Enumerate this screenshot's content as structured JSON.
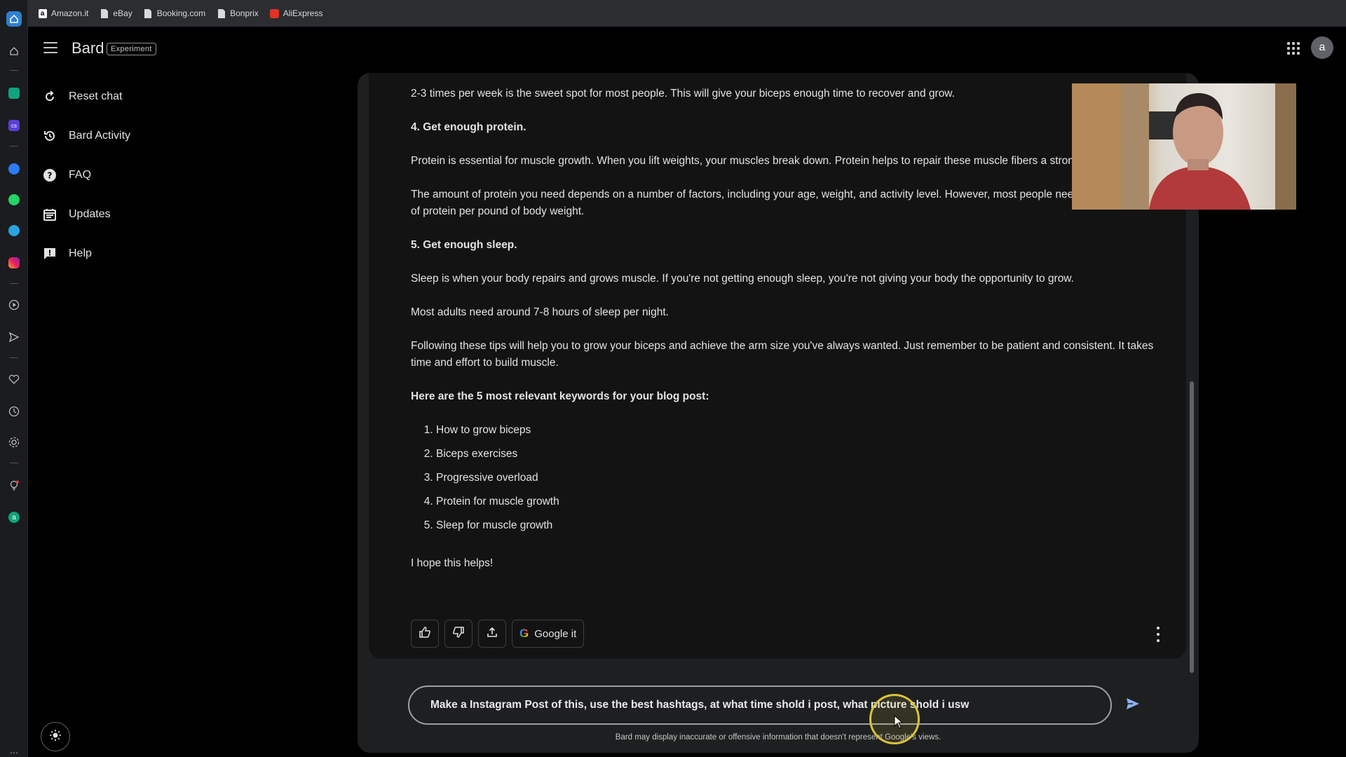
{
  "bookmarks": [
    {
      "label": "Amazon.it",
      "icon": "amazon-icon"
    },
    {
      "label": "eBay",
      "icon": "page-icon"
    },
    {
      "label": "Booking.com",
      "icon": "page-icon"
    },
    {
      "label": "Bonprix",
      "icon": "page-icon"
    },
    {
      "label": "AliExpress",
      "icon": "aliexpress-icon"
    }
  ],
  "header": {
    "brand": "Bard",
    "badge": "Experiment",
    "avatar_letter": "a"
  },
  "sidebar": {
    "items": [
      {
        "label": "Reset chat",
        "icon": "reset-icon"
      },
      {
        "label": "Bard Activity",
        "icon": "history-icon"
      },
      {
        "label": "FAQ",
        "icon": "help-circle-icon"
      },
      {
        "label": "Updates",
        "icon": "calendar-icon"
      },
      {
        "label": "Help",
        "icon": "feedback-icon"
      }
    ]
  },
  "response": {
    "paragraphs": [
      "2-3 times per week is the sweet spot for most people. This will give your biceps enough time to recover and grow.",
      "4. Get enough protein.",
      "Protein is essential for muscle growth. When you lift weights, your muscles break down. Protein helps to repair these muscle fibers a stronger.",
      "The amount of protein you need depends on a number of factors, including your age, weight, and activity level. However, most people need around 1 gram of protein per pound of body weight.",
      "5. Get enough sleep.",
      "Sleep is when your body repairs and grows muscle. If you're not getting enough sleep, you're not giving your body the opportunity to grow.",
      "Most adults need around 7-8 hours of sleep per night.",
      "Following these tips will help you to grow your biceps and achieve the arm size you've always wanted. Just remember to be patient and consistent. It takes time and effort to build muscle.",
      "Here are the 5 most relevant keywords for your blog post:"
    ],
    "keywords": [
      "How to grow biceps",
      "Biceps exercises",
      "Progressive overload",
      "Protein for muscle growth",
      "Sleep for muscle growth"
    ],
    "closing": "I hope this helps!",
    "google_it_label": "Google it"
  },
  "input": {
    "value": "Make a Instagram Post of this, use the best hashtags, at what time shold i post, what picture shold i usw"
  },
  "disclaimer": "Bard may display inaccurate or offensive information that doesn't represent Google's views."
}
